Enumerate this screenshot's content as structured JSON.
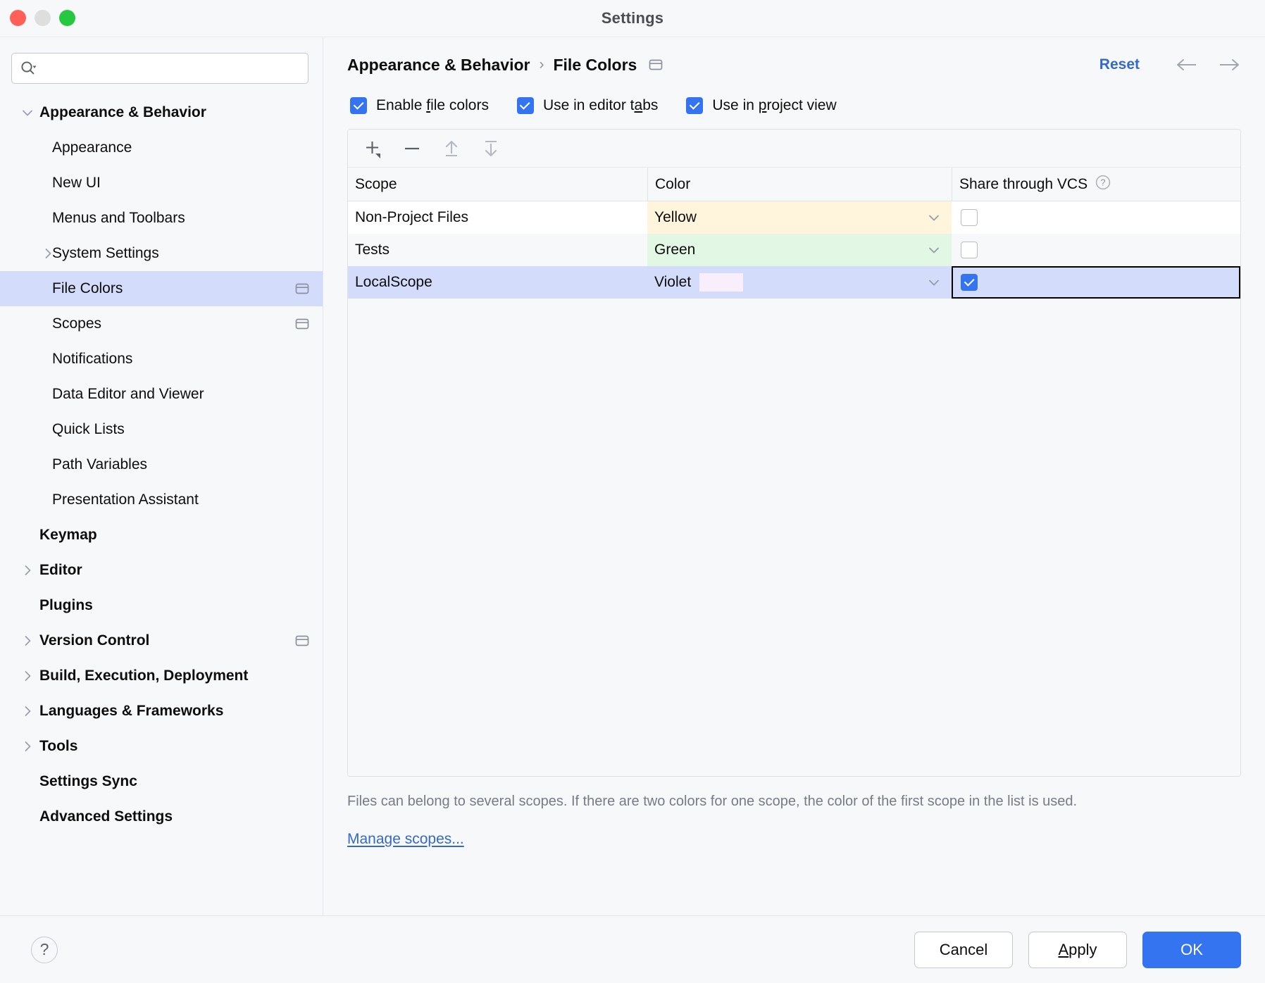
{
  "window": {
    "title": "Settings",
    "traffic_lights": [
      "close",
      "minimize",
      "zoom"
    ]
  },
  "search": {
    "value": "",
    "placeholder": ""
  },
  "sidebar": {
    "items": [
      {
        "label": "Appearance & Behavior",
        "level": 0,
        "bold": true,
        "twisty": "down",
        "badge": false,
        "selected": false
      },
      {
        "label": "Appearance",
        "level": 1,
        "bold": false,
        "twisty": "none",
        "badge": false,
        "selected": false
      },
      {
        "label": "New UI",
        "level": 1,
        "bold": false,
        "twisty": "none",
        "badge": false,
        "selected": false
      },
      {
        "label": "Menus and Toolbars",
        "level": 1,
        "bold": false,
        "twisty": "none",
        "badge": false,
        "selected": false
      },
      {
        "label": "System Settings",
        "level": 1,
        "bold": false,
        "twisty": "right",
        "badge": false,
        "selected": false
      },
      {
        "label": "File Colors",
        "level": 1,
        "bold": false,
        "twisty": "none",
        "badge": true,
        "selected": true
      },
      {
        "label": "Scopes",
        "level": 1,
        "bold": false,
        "twisty": "none",
        "badge": true,
        "selected": false
      },
      {
        "label": "Notifications",
        "level": 1,
        "bold": false,
        "twisty": "none",
        "badge": false,
        "selected": false
      },
      {
        "label": "Data Editor and Viewer",
        "level": 1,
        "bold": false,
        "twisty": "none",
        "badge": false,
        "selected": false
      },
      {
        "label": "Quick Lists",
        "level": 1,
        "bold": false,
        "twisty": "none",
        "badge": false,
        "selected": false
      },
      {
        "label": "Path Variables",
        "level": 1,
        "bold": false,
        "twisty": "none",
        "badge": false,
        "selected": false
      },
      {
        "label": "Presentation Assistant",
        "level": 1,
        "bold": false,
        "twisty": "none",
        "badge": false,
        "selected": false
      },
      {
        "label": "Keymap",
        "level": 0,
        "bold": true,
        "twisty": "none",
        "badge": false,
        "selected": false
      },
      {
        "label": "Editor",
        "level": 0,
        "bold": true,
        "twisty": "right",
        "badge": false,
        "selected": false
      },
      {
        "label": "Plugins",
        "level": 0,
        "bold": true,
        "twisty": "none",
        "badge": false,
        "selected": false
      },
      {
        "label": "Version Control",
        "level": 0,
        "bold": true,
        "twisty": "right",
        "badge": true,
        "selected": false
      },
      {
        "label": "Build, Execution, Deployment",
        "level": 0,
        "bold": true,
        "twisty": "right",
        "badge": false,
        "selected": false
      },
      {
        "label": "Languages & Frameworks",
        "level": 0,
        "bold": true,
        "twisty": "right",
        "badge": false,
        "selected": false
      },
      {
        "label": "Tools",
        "level": 0,
        "bold": true,
        "twisty": "right",
        "badge": false,
        "selected": false
      },
      {
        "label": "Settings Sync",
        "level": 0,
        "bold": true,
        "twisty": "none",
        "badge": false,
        "selected": false
      },
      {
        "label": "Advanced Settings",
        "level": 0,
        "bold": true,
        "twisty": "none",
        "badge": false,
        "selected": false
      }
    ]
  },
  "header": {
    "breadcrumb_parent": "Appearance & Behavior",
    "breadcrumb_sep": "›",
    "breadcrumb_current": "File Colors",
    "reset_label": "Reset",
    "back_arrow": "←",
    "forward_arrow": "→"
  },
  "options": [
    {
      "label_pre": "Enable ",
      "mnemonic": "f",
      "label_post": "ile colors",
      "checked": true
    },
    {
      "label_pre": "Use in editor t",
      "mnemonic": "a",
      "label_post": "bs",
      "checked": true
    },
    {
      "label_pre": "Use in ",
      "mnemonic": "p",
      "label_post": "roject view",
      "checked": true
    }
  ],
  "toolbar": {
    "add_label": "+",
    "remove_label": "−",
    "move_up_label": "Move Up",
    "move_down_label": "Move Down"
  },
  "table": {
    "columns": [
      "Scope",
      "Color",
      "Share through VCS"
    ],
    "vcs_help_glyph": "?",
    "rows": [
      {
        "scope": "Non-Project Files",
        "color": "Yellow",
        "row_bg": "#ffffff",
        "color_bg": "#fff4dc",
        "swatch": null,
        "shared": false,
        "selected": false,
        "focused_cell": false
      },
      {
        "scope": "Tests",
        "color": "Green",
        "row_bg": "#f7f8fa",
        "color_bg": "#e3f7e5",
        "swatch": null,
        "shared": false,
        "selected": false,
        "focused_cell": false
      },
      {
        "scope": "LocalScope",
        "color": "Violet",
        "row_bg": "#d4dcfb",
        "color_bg": "#d4dcfb",
        "swatch": "#f9eefc",
        "shared": true,
        "selected": true,
        "focused_cell": true
      }
    ]
  },
  "note": {
    "text": "Files can belong to several scopes. If there are two colors for one scope, the color of the first scope in the list is used."
  },
  "manage_scopes": {
    "mnemonic": "M",
    "rest": "anage scopes..."
  },
  "footer": {
    "help_glyph": "?",
    "cancel_label": "Cancel",
    "apply_mnemonic": "A",
    "apply_rest": "pply",
    "ok_label": "OK"
  },
  "colors": {
    "accent": "#3574f0",
    "link": "#3469c9",
    "selection": "#d4dcfb",
    "panel": "#f7f8fa"
  }
}
